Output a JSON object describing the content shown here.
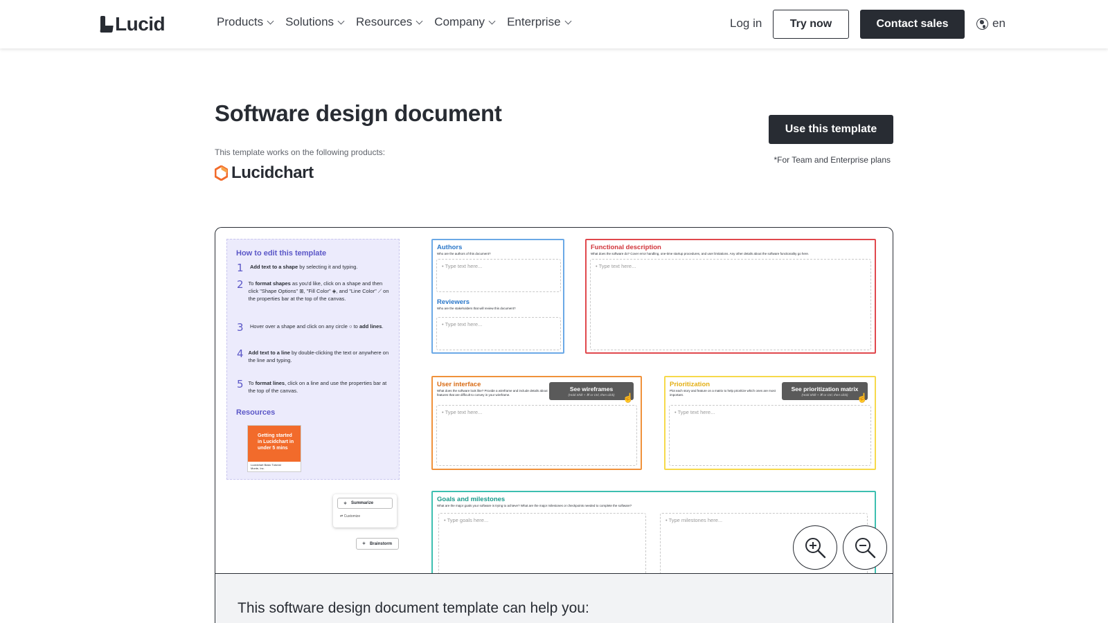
{
  "nav": {
    "logo": "Lucid",
    "menu": [
      "Products",
      "Solutions",
      "Resources",
      "Company",
      "Enterprise"
    ],
    "login": "Log in",
    "try_now": "Try now",
    "contact_sales": "Contact sales",
    "language": "en"
  },
  "header": {
    "title": "Software design document",
    "works_on": "This template works on the following products:",
    "product": "Lucidchart",
    "cta": "Use this template",
    "plans_note": "*For Team and Enterprise plans"
  },
  "preview": {
    "howto": {
      "title": "How to edit this template",
      "steps": [
        {
          "num": "1",
          "bold": "Add text to a shape",
          "text": " by selecting it and typing."
        },
        {
          "num": "2",
          "pre": "To ",
          "bold": "format shapes",
          "text": " as you'd like, click on a shape and then click \"Shape Options\" ⊞, \"Fill Color\" ◈, and \"Line Color\" ⟋ on the properties bar at the top of the canvas."
        },
        {
          "num": "3",
          "pre": "Hover over a shape and click on any circle ○ to ",
          "bold": "add lines",
          "text": "."
        },
        {
          "num": "4",
          "bold": "Add text to a line",
          "text": " by double-clicking the text or anywhere on the line and typing."
        },
        {
          "num": "5",
          "pre": "To ",
          "bold": "format lines",
          "text": ", click on a line and use the properties bar at the top of the canvas."
        }
      ],
      "resources_title": "Resources",
      "resource_card": "Getting started in Lucidchart in under 5 mins",
      "resource_card_sub": "Lucidchart Basic Tutorial",
      "resource_card_org": "Monte, Inc."
    },
    "controls": {
      "summarize": "Summarize",
      "customize": "Customize",
      "brainstorm": "Brainstorm"
    },
    "authors": {
      "title": "Authors",
      "sub": "Who are the authors of this document?",
      "placeholder": "• Type text here..."
    },
    "reviewers": {
      "title": "Reviewers",
      "sub": "Who are the stakeholders that will review this document?",
      "placeholder": "• Type text here..."
    },
    "functional": {
      "title": "Functional description",
      "sub": "What does the software do? Cover error handling, one-time startup procedures, and user limitations. Any other details about the software functionality go here.",
      "placeholder": "• Type text here..."
    },
    "ui": {
      "title": "User interface",
      "sub": "What does the software look like? Provide a wireframe and include details about features that are difficult to convey in your wireframe.",
      "placeholder": "• Type text here...",
      "button": "See wireframes",
      "button_hint": "(Hold Shift + ⌘ or Ctrl, then click)"
    },
    "prioritization": {
      "title": "Prioritization",
      "sub": "Plot each story and feature on a matrix to help prioritize which ones are most important.",
      "placeholder": "• Type text here...",
      "button": "See prioritization matrix",
      "button_hint": "(Hold Shift + ⌘ or Ctrl, then click)"
    },
    "goals": {
      "title": "Goals and milestones",
      "sub": "What are the major goals your software is trying to achieve? What are the major milestones or checkpoints needed to complete the software?",
      "placeholder_goals": "• Type goals here...",
      "placeholder_milestones": "• Type milestones here..."
    }
  },
  "band": {
    "text": "This software design document template can help you:"
  },
  "colors": {
    "dark": "#282c33",
    "howto_bg": "#ecebfc",
    "howto_accent": "#5b57c7",
    "authors": "#6aa8e6",
    "functional": "#e0474c",
    "ui": "#f0913a",
    "prioritization": "#f6d94a",
    "goals": "#3cbfb0",
    "lucidchart_orange": "#f26b2b"
  }
}
